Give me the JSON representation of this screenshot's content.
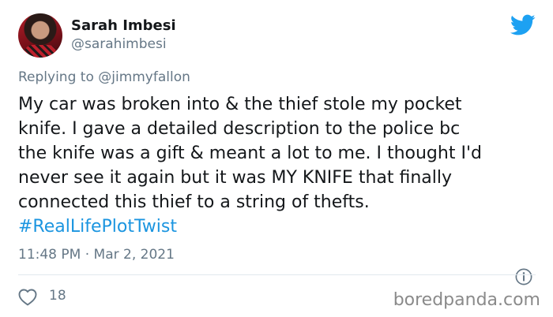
{
  "author": {
    "name": "Sarah Imbesi",
    "handle": "@sarahimbesi"
  },
  "reply_to": "Replying to @jimmyfallon",
  "tweet": {
    "lines": [
      "My car was broken into & the thief stole my pocket",
      "knife. I gave a detailed description to the police bc",
      "the knife was a gift & meant a lot to me. I thought I'd",
      "never see it again but it was MY KNIFE that finally",
      "connected this thief to a string of thefts."
    ],
    "hashtag": "#RealLifePlotTwist"
  },
  "timestamp": "11:48 PM · Mar 2, 2021",
  "likes": "18",
  "watermark": "boredpanda.com",
  "colors": {
    "brand": "#1da1f2",
    "hashtag": "#1b95e0",
    "muted": "#657786",
    "text": "#14171a"
  },
  "icons": {
    "logo": "twitter-bird-icon",
    "info": "info-icon",
    "like": "heart-icon"
  }
}
